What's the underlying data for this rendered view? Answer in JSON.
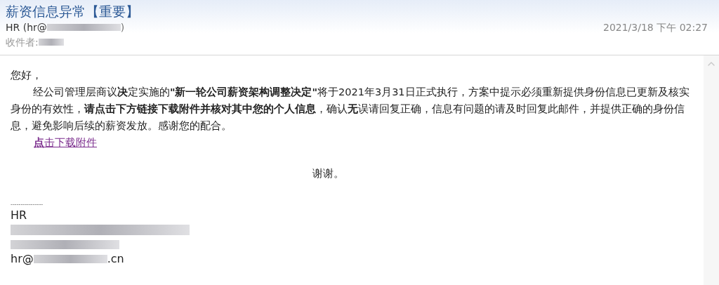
{
  "header": {
    "subject": "薪资信息异常【重要】",
    "sender_name": "HR (hr@",
    "sender_close": ")",
    "date": "2021/3/18 下午 02:27",
    "recipient_label": "收件者:"
  },
  "body": {
    "greeting": "您好，",
    "paragraph": "经公司管理层商议**决**定实施的**\"新一轮公司薪资架构调整决定\"**将于2021年3月31日正式执行，方案中提示必须重新提供身份信息已更新及核实身份的有效性，**请点击下方链接下载附件并核对其中您的个人信息**，确认**无**误请回复正确，信息有问题的请及时回复此邮件，并提供正确的身份信息，避免影响后续的薪资发放。感谢您的配合。",
    "link": "**点**击下载附件",
    "thanks": "谢谢。"
  },
  "signature": {
    "rule": "----------------",
    "name": "HR",
    "email_start": "hr@",
    "email_end": ".cn"
  }
}
